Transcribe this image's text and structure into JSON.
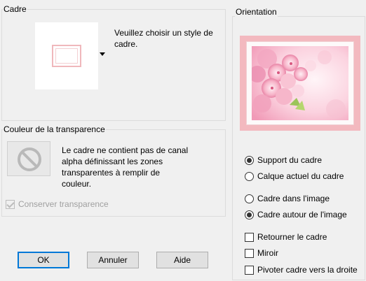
{
  "cadre": {
    "title": "Cadre",
    "message": [
      "Veuillez choisir un style de",
      "cadre."
    ]
  },
  "transparence": {
    "title": "Couleur de la transparence",
    "message": [
      "Le cadre ne contient pas de canal",
      "alpha définissant les zones",
      "transparentes à remplir de",
      "couleur."
    ],
    "conserver_label": "Conserver transparence",
    "conserver_checked": true,
    "conserver_enabled": false
  },
  "buttons": {
    "ok": "OK",
    "annuler": "Annuler",
    "aide": "Aide"
  },
  "orientation": {
    "title": "Orientation",
    "support_du_cadre": "Support du cadre",
    "calque_actuel": "Calque actuel du cadre",
    "cadre_dans_image": "Cadre dans l'image",
    "cadre_autour_image": "Cadre autour de l'image",
    "retourner": "Retourner le cadre",
    "miroir": "Miroir",
    "pivoter": "Pivoter cadre vers la droite",
    "selected_source": "support_du_cadre",
    "selected_placement": "cadre_autour_image",
    "retourner_checked": false,
    "miroir_checked": false,
    "pivoter_checked": false
  },
  "colors": {
    "frame_pink": "#f3b9bf",
    "accent_blue": "#0078d7",
    "blossom_pink": "#f4a7c0"
  }
}
